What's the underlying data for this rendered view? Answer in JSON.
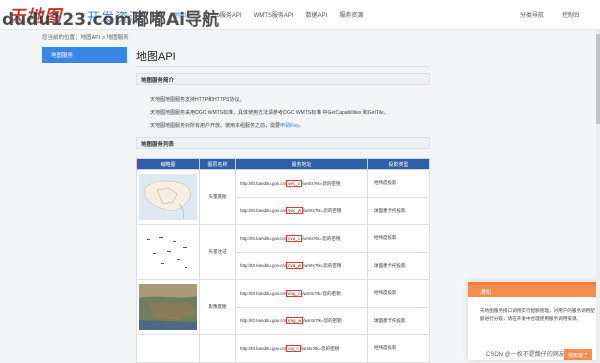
{
  "header": {
    "logo_text": "天地图",
    "logo_sub": "www.tianditu.gov.cn",
    "brand": "开发资源",
    "nav": [
      "首页",
      "地图API",
      "Web服务API",
      "WMTS服务API",
      "数据API",
      "服务资源"
    ],
    "active_nav": "地图API",
    "right_links": [
      "分类导航",
      "控制台"
    ]
  },
  "watermark": "dudu123.com嘟嘟Ai导航",
  "breadcrumb": "您当前的位置：地图API > 地图服务",
  "sidebar": {
    "active_item": "地图服务"
  },
  "main": {
    "title": "地图API",
    "intro_heading": "地图服务简介",
    "intro_lines": [
      "天地图地图服务支持HTTP和HTTPS协议。",
      "天地图地图服务采用OGC WMTS标准，具体使用方法请参考OGC WMTS标准 中GetCapabilities 和GetTile。",
      "天地图地图服务对所有用户开放。使用本组服务之前，需要"
    ],
    "apply_link": "申请Key",
    "period": "。",
    "list_heading": "地图服务列表",
    "table": {
      "headers": [
        "缩略图",
        "图层名称",
        "服务地址",
        "投影类型"
      ],
      "groups": [
        {
          "name": "矢量底图",
          "thumb": "map-thumbnail-vector",
          "rows": [
            {
              "url_pre": "http://t0.tianditu.gov.cn/",
              "url_hl": "vec_c",
              "url_post": "/wmts?tk=您的密钥",
              "projection": "经纬度投影"
            },
            {
              "url_pre": "http://t0.tianditu.gov.cn/",
              "url_hl": "vec_w",
              "url_post": "/wmts?tk=您的密钥",
              "projection": "球面墨卡托投影"
            }
          ]
        },
        {
          "name": "矢量注记",
          "thumb": "map-thumbnail-annotation",
          "rows": [
            {
              "url_pre": "http://t0.tianditu.gov.cn/",
              "url_hl": "cva_c",
              "url_post": "/wmts?tk=您的密钥",
              "projection": "经纬度投影"
            },
            {
              "url_pre": "http://t0.tianditu.gov.cn/",
              "url_hl": "cva_w",
              "url_post": "/wmts?tk=您的密钥",
              "projection": "球面墨卡托投影"
            }
          ]
        },
        {
          "name": "影像底图",
          "thumb": "map-thumbnail-imagery",
          "rows": [
            {
              "url_pre": "http://t0.tianditu.gov.cn/",
              "url_hl": "img_c",
              "url_post": "/wmts?tk=您的密钥",
              "projection": "经纬度投影"
            },
            {
              "url_pre": "http://t0.tianditu.gov.cn/",
              "url_hl": "img_w",
              "url_post": "/wmts?tk=您的密钥",
              "projection": "球面墨卡托投影"
            }
          ]
        },
        {
          "name": "",
          "thumb": "map-thumbnail-partial",
          "rows": [
            {
              "url_pre": "http://t0.tianditu.gov.cn/",
              "url_hl": "cia_c",
              "url_post": "/wmts?tk=您的密钥",
              "projection": "经纬度投影"
            }
          ]
        }
      ]
    }
  },
  "toast": {
    "title": "通知",
    "body": "天地图服务接口调用实行配额管理，对用户的服务调用配额进行分级，请在开发中合理使用服务调用资源。",
    "button": "我知道了"
  },
  "csdn_credit": "CSDN @一枚不是靓仔的网友",
  "colors": {
    "accent": "#2f7fd8",
    "sidebar_active": "#3a86e6",
    "table_header": "#2f5fa8",
    "toast": "#f68c4e",
    "highlight_box": "#e23b2e"
  }
}
